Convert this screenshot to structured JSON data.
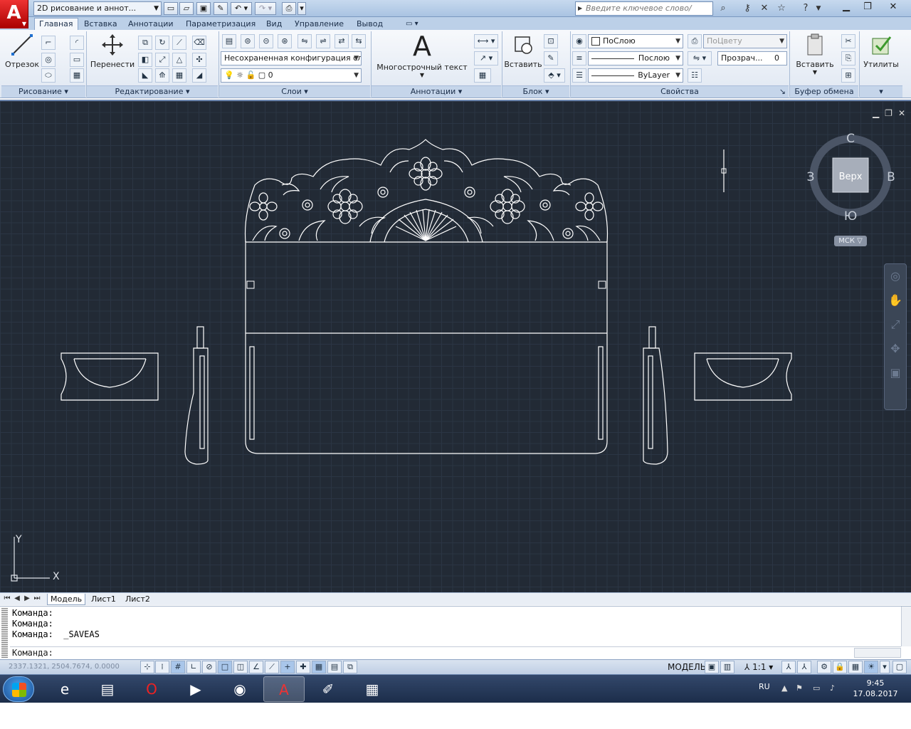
{
  "titlebar": {
    "logo": "A",
    "workspace": "2D рисование и аннот...",
    "search_placeholder": "Введите ключевое слово/фразу",
    "help": "?"
  },
  "tabs": [
    "Главная",
    "Вставка",
    "Аннотации",
    "Параметризация",
    "Вид",
    "Управление",
    "Вывод"
  ],
  "active_tab": "Главная",
  "ribbon": {
    "draw": {
      "title": "Рисование",
      "line_label": "Отрезок"
    },
    "modify": {
      "title": "Редактирование",
      "move_label": "Перенести"
    },
    "layers": {
      "title": "Слои",
      "layer_state": "Несохраненная конфигурация сл",
      "current_layer": "0"
    },
    "annotation": {
      "title": "Аннотации",
      "mtext_label": "Многострочный текст",
      "mtext_glyph": "A"
    },
    "block": {
      "title": "Блок",
      "insert_label": "Вставить"
    },
    "properties": {
      "title": "Свойства",
      "color": "ПоСлою",
      "lineweight": "Послою",
      "linetype": "ByLayer",
      "plot_style": "ПоЦвету",
      "transparency_label": "Прозрач...",
      "transparency_value": "0"
    },
    "clipboard": {
      "title": "Буфер обмена",
      "paste_label": "Вставить"
    },
    "utilities": {
      "label": "Утилиты"
    }
  },
  "viewcube": {
    "north": "С",
    "south": "Ю",
    "west": "З",
    "east": "В",
    "face": "Верх",
    "ucs_label": "МСК"
  },
  "ucs_icon": {
    "x": "X",
    "y": "Y"
  },
  "layout_tabs": [
    "Модель",
    "Лист1",
    "Лист2"
  ],
  "active_layout": "Модель",
  "command_history": [
    "Команда:",
    "Команда:",
    "Команда:  _SAVEAS"
  ],
  "command_prompt": "Команда:",
  "statusbar": {
    "coords": "2337.1321, 2504.7674, 0.0000",
    "space": "МОДЕЛЬ",
    "scale": "1:1"
  },
  "taskbar": {
    "lang": "RU",
    "time": "9:45",
    "date": "17.08.2017"
  },
  "colors": {
    "drawing_background": "#222a35",
    "linework": "#ffffff",
    "ribbon": "#dfe7f2",
    "titlebar": "#b8cde6"
  }
}
